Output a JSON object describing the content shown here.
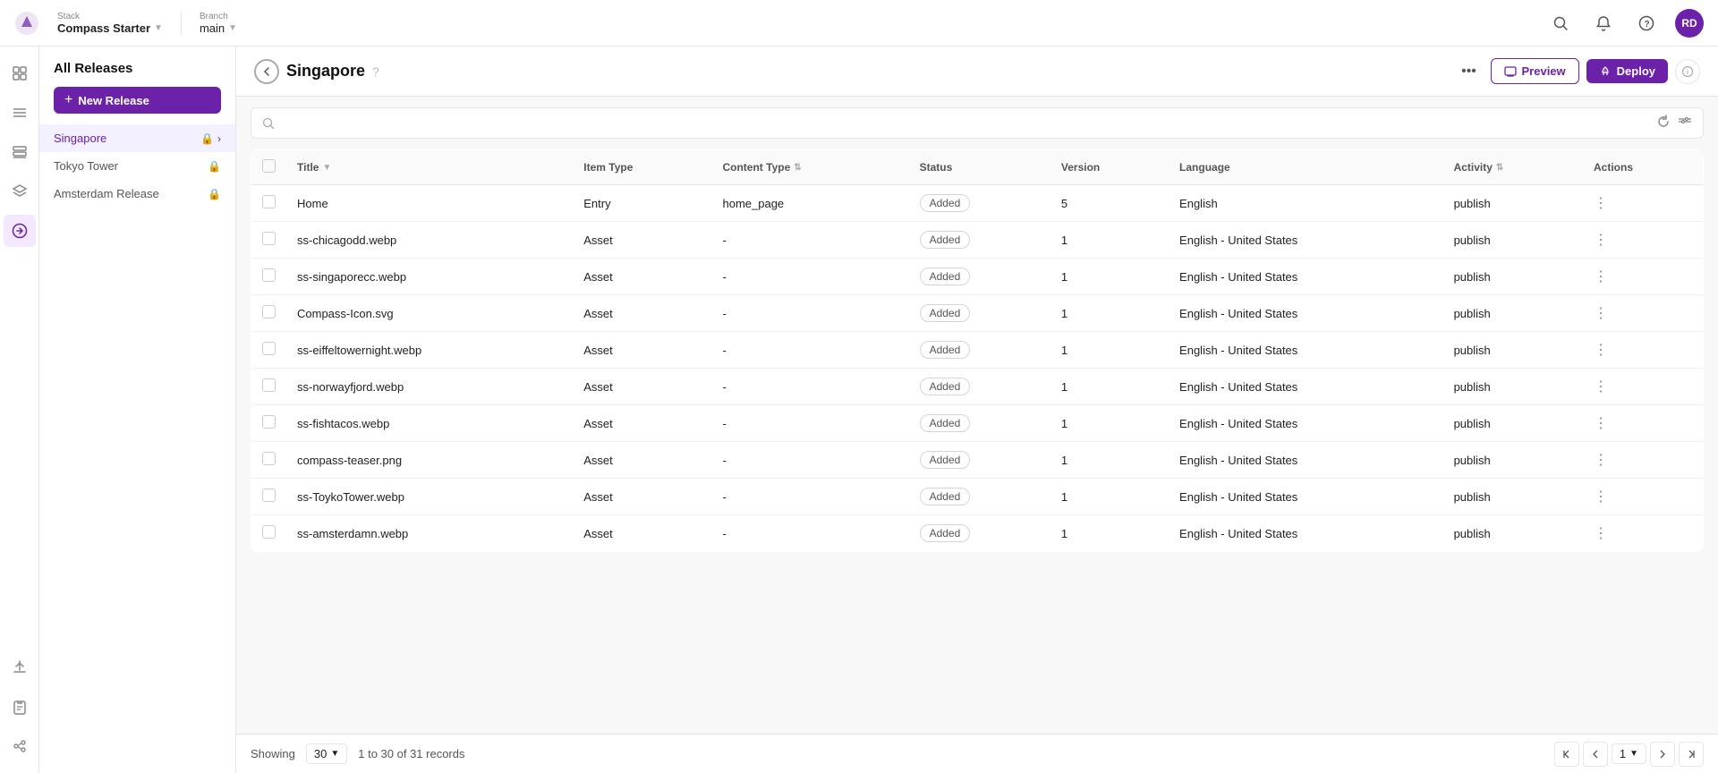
{
  "topbar": {
    "stack_label": "Stack",
    "stack_name": "Compass Starter",
    "branch_label": "Branch",
    "branch_name": "main",
    "user_initials": "RD"
  },
  "sidebar": {
    "title": "All Releases",
    "new_release_label": "New Release",
    "items": [
      {
        "id": "singapore",
        "label": "Singapore",
        "active": true
      },
      {
        "id": "tokyo-tower",
        "label": "Tokyo Tower",
        "active": false
      },
      {
        "id": "amsterdam-release",
        "label": "Amsterdam Release",
        "active": false
      }
    ]
  },
  "content": {
    "back_tooltip": "back",
    "title": "Singapore",
    "more_label": "...",
    "preview_label": "Preview",
    "deploy_label": "Deploy",
    "search_placeholder": "",
    "columns": [
      {
        "id": "title",
        "label": "Title",
        "sortable": true
      },
      {
        "id": "item_type",
        "label": "Item Type",
        "sortable": false
      },
      {
        "id": "content_type",
        "label": "Content Type",
        "sortable": true
      },
      {
        "id": "status",
        "label": "Status",
        "sortable": false
      },
      {
        "id": "version",
        "label": "Version",
        "sortable": false
      },
      {
        "id": "language",
        "label": "Language",
        "sortable": false
      },
      {
        "id": "activity",
        "label": "Activity",
        "sortable": true
      },
      {
        "id": "actions",
        "label": "Actions",
        "sortable": false
      }
    ],
    "rows": [
      {
        "title": "Home",
        "item_type": "Entry",
        "content_type": "home_page",
        "status": "Added",
        "version": "5",
        "language": "English",
        "activity": "publish"
      },
      {
        "title": "ss-chicagodd.webp",
        "item_type": "Asset",
        "content_type": "-",
        "status": "Added",
        "version": "1",
        "language": "English - United States",
        "activity": "publish"
      },
      {
        "title": "ss-singaporecc.webp",
        "item_type": "Asset",
        "content_type": "-",
        "status": "Added",
        "version": "1",
        "language": "English - United States",
        "activity": "publish"
      },
      {
        "title": "Compass-Icon.svg",
        "item_type": "Asset",
        "content_type": "-",
        "status": "Added",
        "version": "1",
        "language": "English - United States",
        "activity": "publish"
      },
      {
        "title": "ss-eiffeltowernight.webp",
        "item_type": "Asset",
        "content_type": "-",
        "status": "Added",
        "version": "1",
        "language": "English - United States",
        "activity": "publish"
      },
      {
        "title": "ss-norwayfjord.webp",
        "item_type": "Asset",
        "content_type": "-",
        "status": "Added",
        "version": "1",
        "language": "English - United States",
        "activity": "publish"
      },
      {
        "title": "ss-fishtacos.webp",
        "item_type": "Asset",
        "content_type": "-",
        "status": "Added",
        "version": "1",
        "language": "English - United States",
        "activity": "publish"
      },
      {
        "title": "compass-teaser.png",
        "item_type": "Asset",
        "content_type": "-",
        "status": "Added",
        "version": "1",
        "language": "English - United States",
        "activity": "publish"
      },
      {
        "title": "ss-ToykoTower.webp",
        "item_type": "Asset",
        "content_type": "-",
        "status": "Added",
        "version": "1",
        "language": "English - United States",
        "activity": "publish"
      },
      {
        "title": "ss-amsterdamn.webp",
        "item_type": "Asset",
        "content_type": "-",
        "status": "Added",
        "version": "1",
        "language": "English - United States",
        "activity": "publish"
      }
    ],
    "footer": {
      "showing_label": "Showing",
      "per_page": "30",
      "records_label": "1 to 30 of 31 records",
      "current_page": "1"
    }
  }
}
